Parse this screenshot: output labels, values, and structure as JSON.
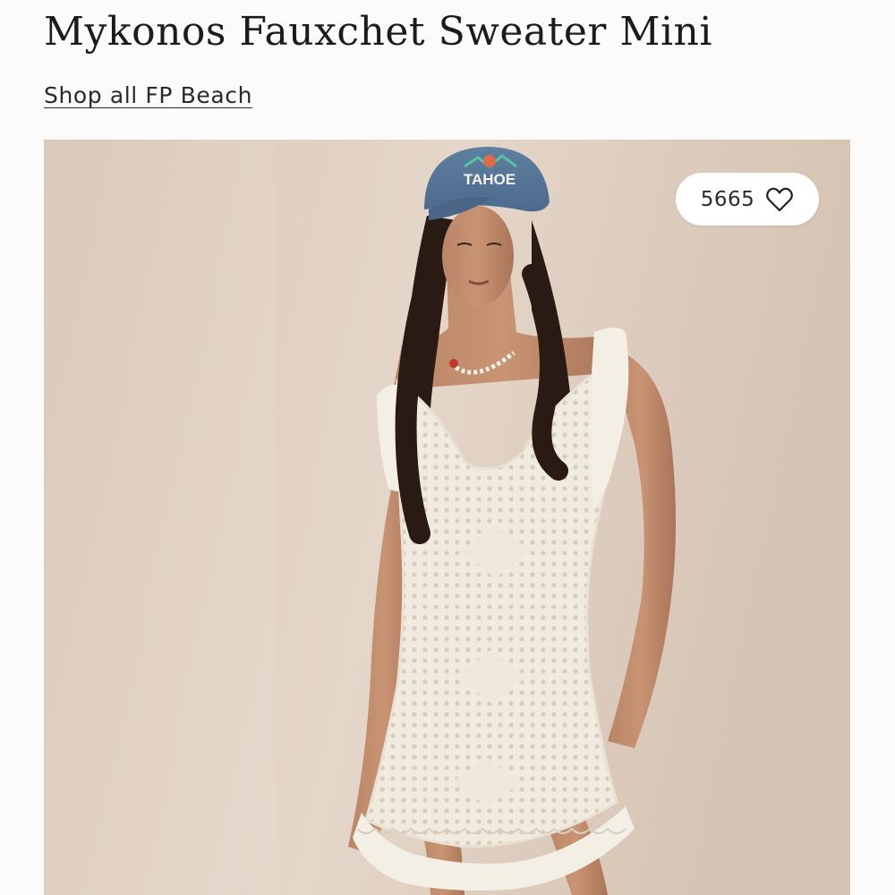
{
  "product": {
    "title": "Mykonos Fauxchet Sweater Mini",
    "shop_all_link": "Shop all FP Beach"
  },
  "gallery": {
    "favorite_count": "5665",
    "favorite_icon": "heart-outline-icon",
    "image_content": "model-in-cream-crochet-mini-dress",
    "cap_text": "TAHOE"
  },
  "colors": {
    "background": "#fdfbfa",
    "text": "#1b1b1b",
    "photo_backdrop": "#dccbbb",
    "pill": "#ffffff"
  }
}
